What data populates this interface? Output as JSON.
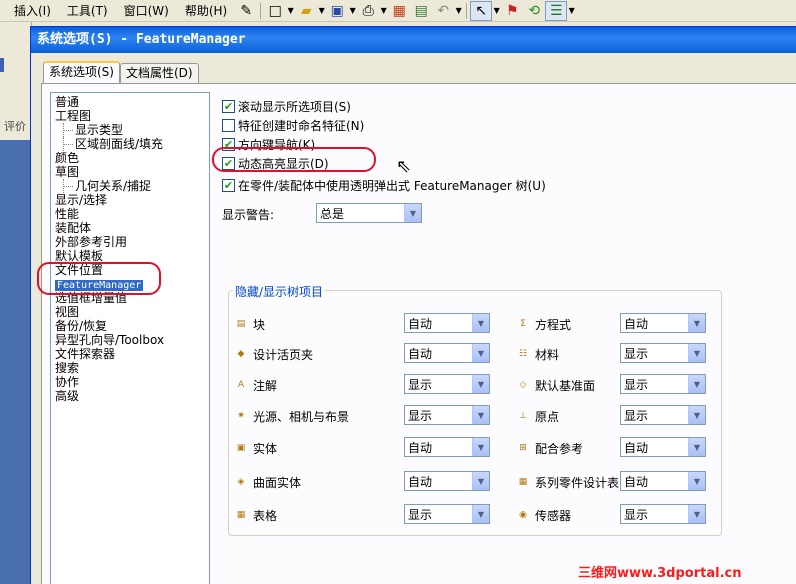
{
  "menubar": {
    "items": [
      "插入(I)",
      "工具(T)",
      "窗口(W)",
      "帮助(H)"
    ],
    "icons": [
      "magic-wand-icon",
      "new-document-icon",
      "open-folder-icon",
      "save-icon",
      "print-icon",
      "options-icon",
      "undo-icon",
      "select-cursor-icon",
      "traffic-light-icon",
      "properties-list-icon"
    ]
  },
  "background_app": {
    "left_tab_label": "评价"
  },
  "dialog": {
    "title": "系统选项(S) - FeatureManager",
    "tabs": [
      "系统选项(S)",
      "文档属性(D)"
    ],
    "active_tab_index": 0
  },
  "tree": {
    "items": [
      {
        "label": "普通",
        "indent": false
      },
      {
        "label": "工程图",
        "indent": false
      },
      {
        "label": "显示类型",
        "indent": true
      },
      {
        "label": "区域剖面线/填充",
        "indent": true
      },
      {
        "label": "颜色",
        "indent": false
      },
      {
        "label": "草图",
        "indent": false
      },
      {
        "label": "几何关系/捕捉",
        "indent": true
      },
      {
        "label": "显示/选择",
        "indent": false
      },
      {
        "label": "性能",
        "indent": false
      },
      {
        "label": "装配体",
        "indent": false
      },
      {
        "label": "外部参考引用",
        "indent": false
      },
      {
        "label": "默认模板",
        "indent": false
      },
      {
        "label": "文件位置",
        "indent": false
      },
      {
        "label": "FeatureManager",
        "indent": false,
        "selected": true
      },
      {
        "label": "选值框增量值",
        "indent": false
      },
      {
        "label": "视图",
        "indent": false
      },
      {
        "label": "备份/恢复",
        "indent": false
      },
      {
        "label": "异型孔向导/Toolbox",
        "indent": false
      },
      {
        "label": "文件探索器",
        "indent": false
      },
      {
        "label": "搜索",
        "indent": false
      },
      {
        "label": "协作",
        "indent": false
      },
      {
        "label": "高级",
        "indent": false
      }
    ]
  },
  "options": {
    "checkboxes": [
      {
        "label": "滚动显示所选项目(S)",
        "checked": true
      },
      {
        "label": "特征创建时命名特征(N)",
        "checked": false
      },
      {
        "label": "方向键导航(K)",
        "checked": true
      },
      {
        "label": "动态高亮显示(D)",
        "checked": true
      },
      {
        "label": "在零件/装配体中使用透明弹出式 FeatureManager 树(U)",
        "checked": true
      }
    ],
    "display_warning_label": "显示警告:",
    "display_warning_value": "总是"
  },
  "hide_show_group": {
    "title": "隐藏/显示树项目",
    "left_items": [
      {
        "label": "块",
        "value": "自动",
        "icon": "block-icon"
      },
      {
        "label": "设计活页夹",
        "value": "自动",
        "icon": "design-binder-icon"
      },
      {
        "label": "注解",
        "value": "显示",
        "icon": "annotation-icon"
      },
      {
        "label": "光源、相机与布景",
        "value": "显示",
        "icon": "lights-camera-icon"
      },
      {
        "label": "实体",
        "value": "自动",
        "icon": "solid-body-icon"
      },
      {
        "label": "曲面实体",
        "value": "自动",
        "icon": "surface-body-icon"
      },
      {
        "label": "表格",
        "value": "显示",
        "icon": "table-icon"
      }
    ],
    "right_items": [
      {
        "label": "方程式",
        "value": "自动",
        "icon": "equation-icon"
      },
      {
        "label": "材料",
        "value": "显示",
        "icon": "material-icon"
      },
      {
        "label": "默认基准面",
        "value": "显示",
        "icon": "default-plane-icon"
      },
      {
        "label": "原点",
        "value": "显示",
        "icon": "origin-icon"
      },
      {
        "label": "配合参考",
        "value": "自动",
        "icon": "mate-reference-icon"
      },
      {
        "label": "系列零件设计表",
        "value": "自动",
        "icon": "design-table-icon"
      },
      {
        "label": "传感器",
        "value": "显示",
        "icon": "sensor-icon"
      }
    ]
  },
  "watermark": "三维网www.3dportal.cn",
  "colors": {
    "title_bar": "#0a5fd8",
    "annotation_red": "#e0102a",
    "group_title": "#0046d5",
    "selection": "#316ac5"
  }
}
